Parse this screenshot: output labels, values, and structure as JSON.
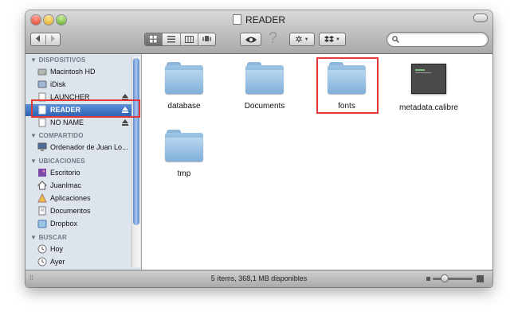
{
  "window": {
    "title": "READER"
  },
  "toolbar": {
    "back_icon": "chevron-left",
    "forward_icon": "chevron-right",
    "view_modes": [
      "icon-view",
      "list-view",
      "column-view",
      "coverflow-view"
    ],
    "selected_view": "icon-view",
    "quicklook_icon": "eye",
    "help_icon": "question-mark",
    "action_icon": "gear",
    "dropbox_icon": "dropbox",
    "search_placeholder": ""
  },
  "sidebar": {
    "sections": [
      {
        "header": "DISPOSITIVOS",
        "items": [
          {
            "label": "Macintosh HD",
            "icon": "hard-drive-icon",
            "eject": false,
            "selected": false
          },
          {
            "label": "iDisk",
            "icon": "idisk-icon",
            "eject": false,
            "selected": false
          },
          {
            "label": "LAUNCHER",
            "icon": "volume-icon",
            "eject": true,
            "selected": false
          },
          {
            "label": "READER",
            "icon": "volume-icon",
            "eject": true,
            "selected": true
          },
          {
            "label": "NO NAME",
            "icon": "volume-icon",
            "eject": true,
            "selected": false
          }
        ]
      },
      {
        "header": "COMPARTIDO",
        "items": [
          {
            "label": "Ordenador de Juan Lo...",
            "icon": "computer-icon",
            "eject": false,
            "selected": false
          }
        ]
      },
      {
        "header": "UBICACIONES",
        "items": [
          {
            "label": "Escritorio",
            "icon": "desktop-icon",
            "eject": false,
            "selected": false
          },
          {
            "label": "JuanImac",
            "icon": "home-icon",
            "eject": false,
            "selected": false
          },
          {
            "label": "Aplicaciones",
            "icon": "applications-icon",
            "eject": false,
            "selected": false
          },
          {
            "label": "Documentos",
            "icon": "documents-icon",
            "eject": false,
            "selected": false
          },
          {
            "label": "Dropbox",
            "icon": "dropbox-icon",
            "eject": false,
            "selected": false
          }
        ]
      },
      {
        "header": "BUSCAR",
        "items": [
          {
            "label": "Hoy",
            "icon": "clock-icon",
            "eject": false,
            "selected": false
          },
          {
            "label": "Ayer",
            "icon": "clock-icon",
            "eject": false,
            "selected": false
          }
        ]
      }
    ]
  },
  "files": [
    {
      "name": "database",
      "kind": "folder",
      "highlighted": false
    },
    {
      "name": "Documents",
      "kind": "folder",
      "highlighted": false
    },
    {
      "name": "fonts",
      "kind": "folder",
      "highlighted": true
    },
    {
      "name": "metadata.calibre",
      "kind": "document",
      "highlighted": false
    },
    {
      "name": "tmp",
      "kind": "folder",
      "highlighted": false
    }
  ],
  "status": {
    "text": "5 ítems, 368,1 MB disponibles",
    "icon_size_level": 0.3
  },
  "colors": {
    "highlight": "#e23a3a",
    "selection": "#3a6fc4",
    "folder": "#8fb7db"
  }
}
